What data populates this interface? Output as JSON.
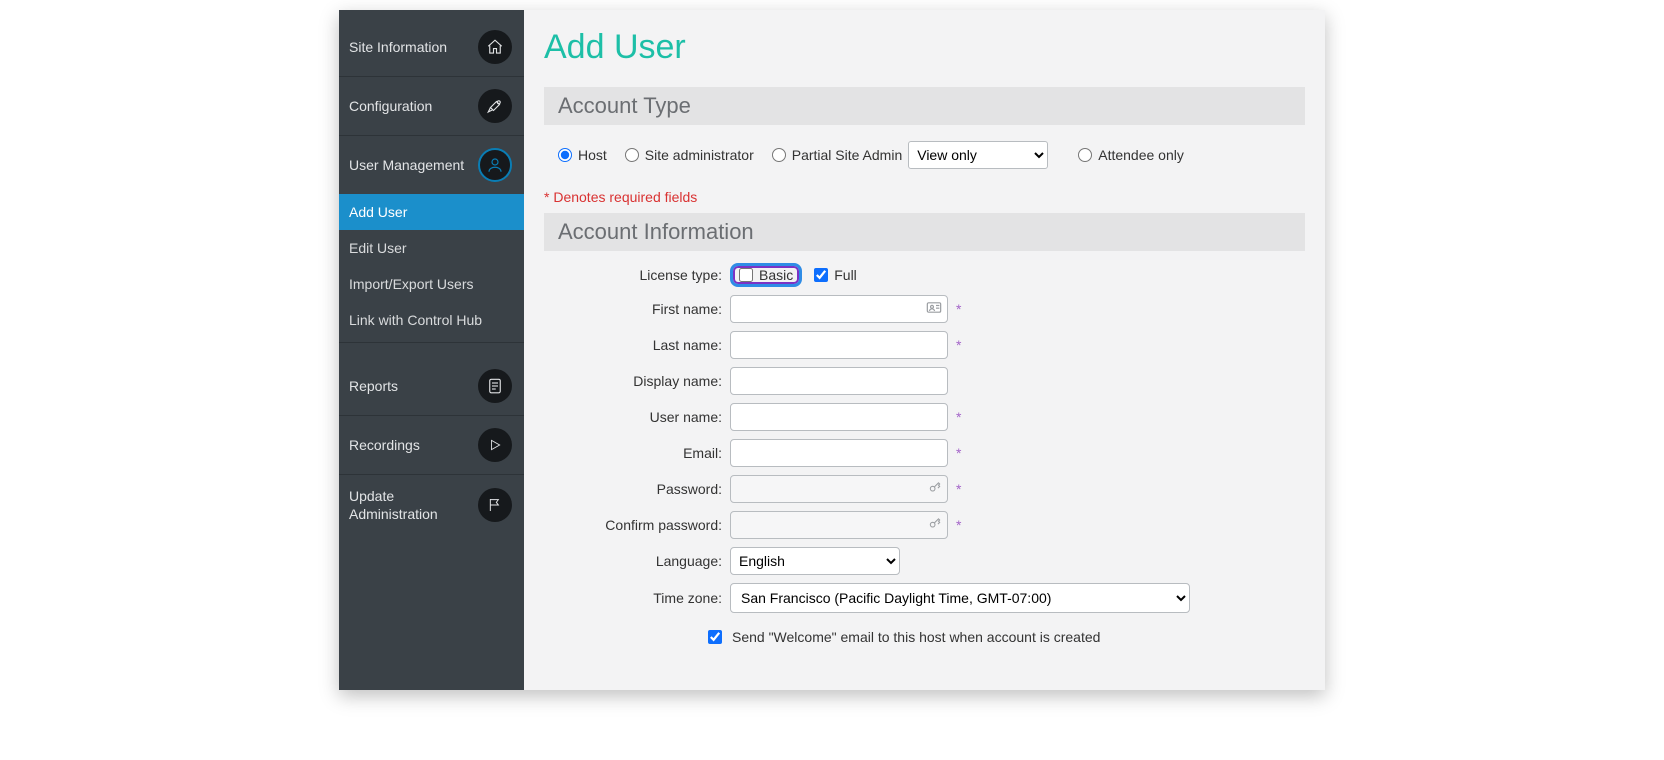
{
  "sidebar": {
    "items": [
      {
        "label": "Site Information",
        "icon": "home-icon"
      },
      {
        "label": "Configuration",
        "icon": "tools-icon"
      },
      {
        "label": "User Management",
        "icon": "user-icon",
        "sub": [
          {
            "label": "Add User",
            "active": true
          },
          {
            "label": "Edit User"
          },
          {
            "label": "Import/Export Users"
          },
          {
            "label": "Link with Control Hub"
          }
        ]
      },
      {
        "label": "Reports",
        "icon": "document-icon"
      },
      {
        "label": "Recordings",
        "icon": "play-icon"
      },
      {
        "label": "Update Administration",
        "icon": "flag-icon"
      }
    ]
  },
  "page": {
    "title": "Add User",
    "required_note": "* Denotes required fields"
  },
  "account_type": {
    "header": "Account Type",
    "host": "Host",
    "site_admin": "Site administrator",
    "partial_admin": "Partial Site Admin",
    "partial_admin_select": "View only",
    "attendee_only": "Attendee only"
  },
  "account_info": {
    "header": "Account Information",
    "labels": {
      "license_type": "License type:",
      "basic": "Basic",
      "full": "Full",
      "first_name": "First name:",
      "last_name": "Last name:",
      "display_name": "Display name:",
      "user_name": "User name:",
      "email": "Email:",
      "password": "Password:",
      "confirm_password": "Confirm password:",
      "language": "Language:",
      "time_zone": "Time zone:",
      "welcome": "Send \"Welcome\" email to this host when account is created"
    },
    "values": {
      "language": "English",
      "time_zone": "San Francisco (Pacific Daylight Time, GMT-07:00)"
    }
  }
}
